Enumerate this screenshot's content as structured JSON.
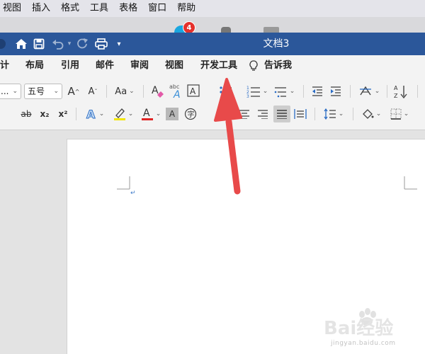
{
  "menubar": {
    "items": [
      "视图",
      "插入",
      "格式",
      "工具",
      "表格",
      "窗口",
      "帮助"
    ]
  },
  "dock": {
    "badge_count": "4"
  },
  "title_bar": {
    "document_title": "文档3"
  },
  "ribbon_tabs": [
    "计",
    "布局",
    "引用",
    "邮件",
    "审阅",
    "视图",
    "开发工具",
    "告诉我"
  ],
  "ribbon": {
    "font_name": "...",
    "font_size": "五号",
    "change_case_label": "Aa",
    "clear_format_label": "abc",
    "subscript_label": "x₂",
    "superscript_label": "x²",
    "strikethrough_label": "ab",
    "grow_font_label": "A",
    "shrink_font_label": "A"
  },
  "document": {
    "paragraph_mark": "↵"
  },
  "watermark": {
    "text": "Bai经验",
    "url": "jingyan.baidu.com"
  },
  "colors": {
    "title_bar": "#2b579a",
    "arrow": "#e84a4a",
    "highlight": "#f2e600",
    "font_color": "#e02424",
    "badge": "#e5312c"
  }
}
